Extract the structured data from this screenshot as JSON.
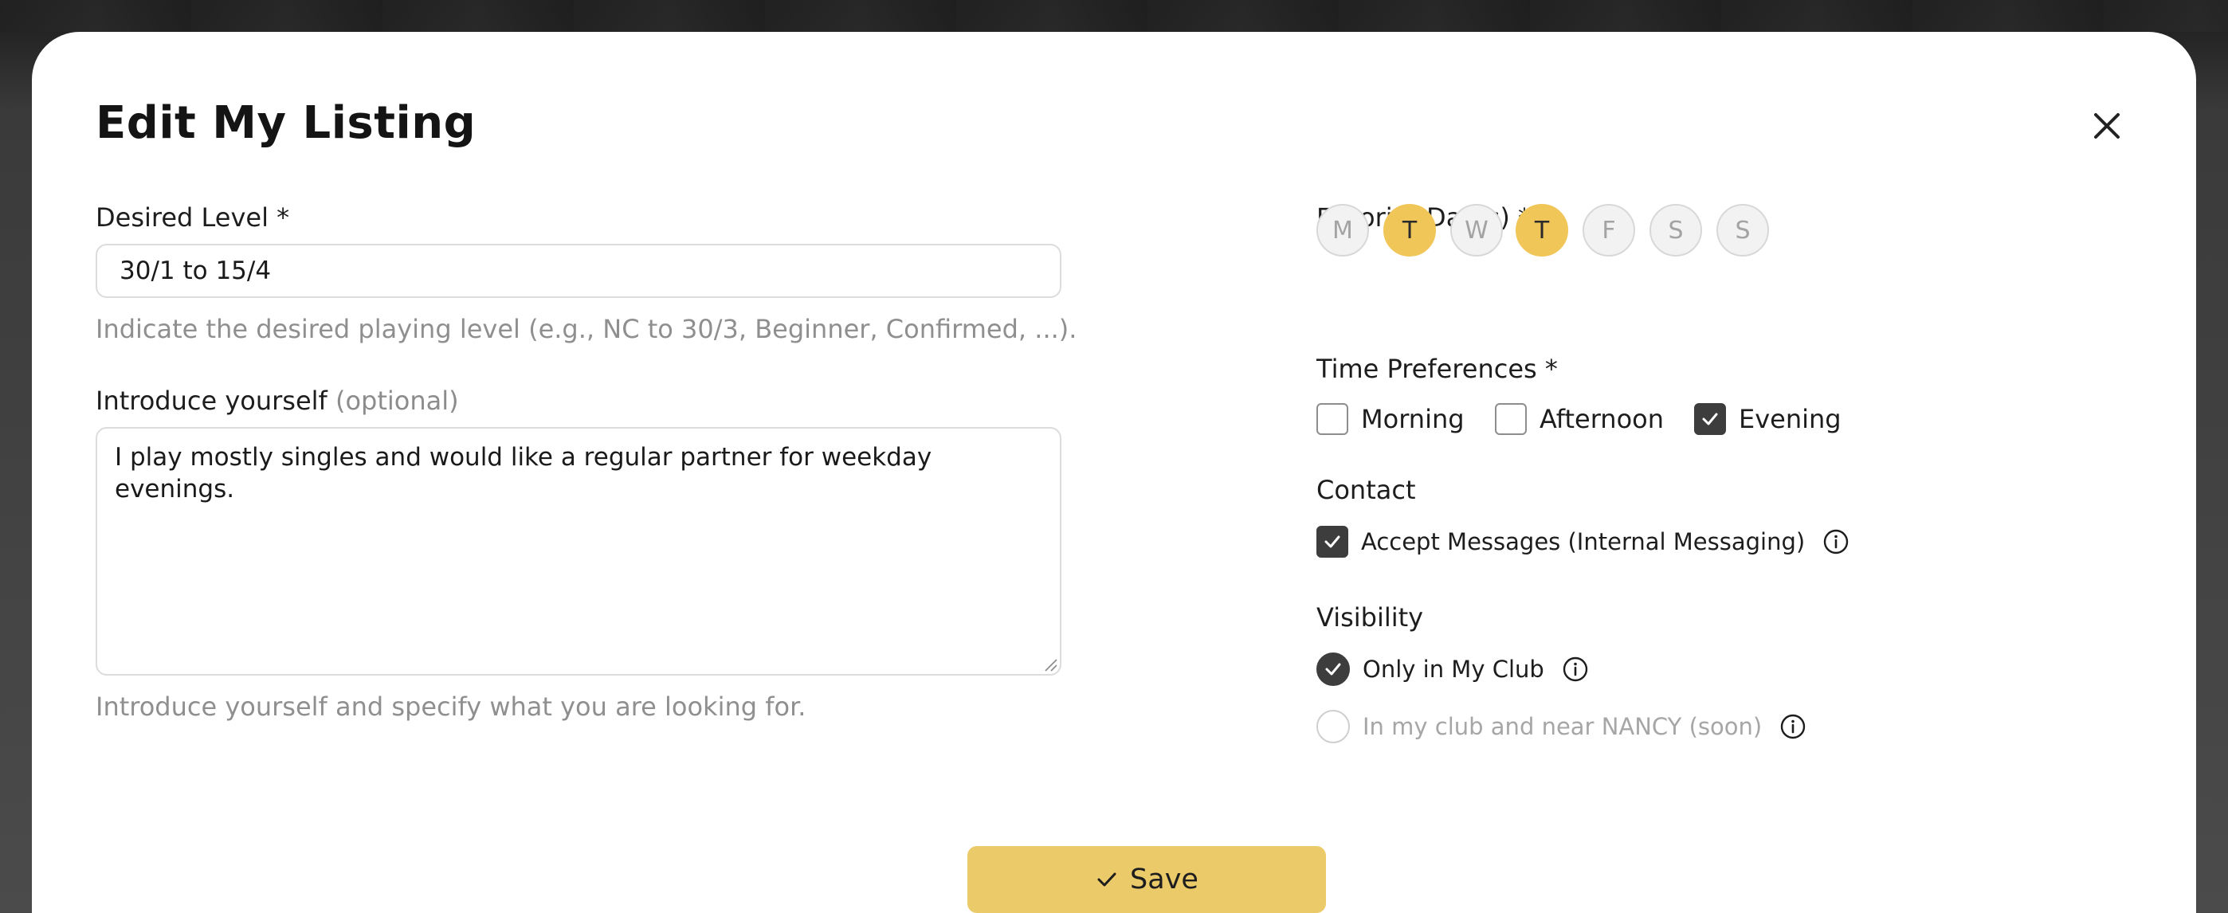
{
  "modal": {
    "title": "Edit My Listing"
  },
  "desired_level": {
    "label": "Desired Level *",
    "value": "30/1 to 15/4",
    "hint": "Indicate the desired playing level (e.g., NC to 30/3, Beginner, Confirmed, ...)."
  },
  "introduce": {
    "label": "Introduce yourself",
    "optional": "(optional)",
    "value": "I play mostly singles and would like a regular partner for weekday evenings.",
    "hint": "Introduce yourself and specify what you are looking for."
  },
  "favorite_days": {
    "label": "Favorite Day(s) *",
    "days": [
      {
        "label": "M",
        "selected": false
      },
      {
        "label": "T",
        "selected": true
      },
      {
        "label": "W",
        "selected": false
      },
      {
        "label": "T",
        "selected": true
      },
      {
        "label": "F",
        "selected": false
      },
      {
        "label": "S",
        "selected": false
      },
      {
        "label": "S",
        "selected": false
      }
    ]
  },
  "time_preferences": {
    "label": "Time Preferences *",
    "options": [
      {
        "label": "Morning",
        "checked": false
      },
      {
        "label": "Afternoon",
        "checked": false
      },
      {
        "label": "Evening",
        "checked": true
      }
    ]
  },
  "contact": {
    "label": "Contact",
    "accept_messages": {
      "label": "Accept Messages (Internal Messaging)",
      "checked": true
    }
  },
  "visibility": {
    "label": "Visibility",
    "options": [
      {
        "label": "Only in My Club",
        "checked": true,
        "disabled": false
      },
      {
        "label": "In my club and near NANCY (soon)",
        "checked": false,
        "disabled": true
      }
    ]
  },
  "actions": {
    "save_label": "Save"
  },
  "colors": {
    "accent": "#ebca6a",
    "day_selected": "#f0c659",
    "checkbox_checked": "#3d3d3d"
  },
  "icons": {
    "close": "close-icon",
    "save": "check-icon",
    "info": "info-icon"
  }
}
